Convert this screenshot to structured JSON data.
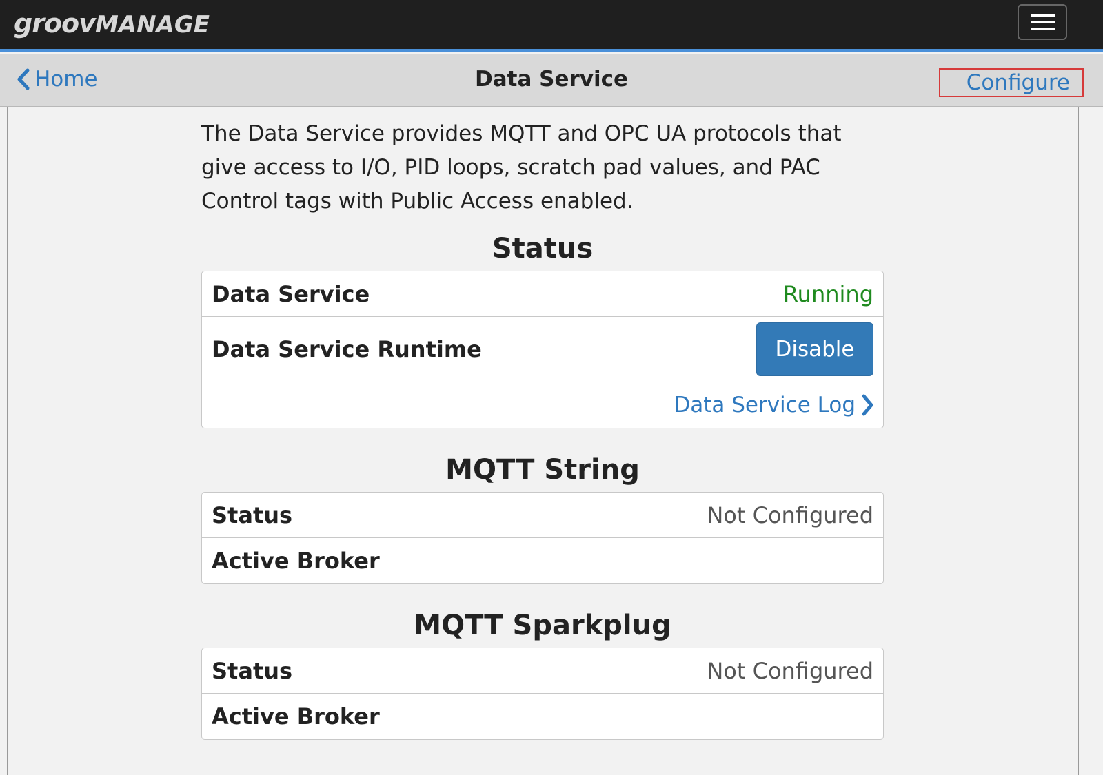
{
  "topbar": {
    "logo_part1": "groov",
    "logo_part2": "MANAGE",
    "menu_icon": "hamburger-icon"
  },
  "subbar": {
    "back_label": "Home",
    "back_icon": "chevron-left-icon",
    "title": "Data Service",
    "configure_label": "Configure"
  },
  "intro": "The Data Service provides MQTT and OPC UA protocols that give access to I/O, PID loops, scratch pad values, and PAC Control tags with Public Access enabled.",
  "status_section": {
    "title": "Status",
    "rows": [
      {
        "label": "Data Service",
        "value": "Running"
      },
      {
        "label": "Data Service Runtime",
        "button": "Disable"
      }
    ],
    "log_link": "Data Service Log",
    "log_icon": "chevron-right-icon"
  },
  "mqtt_string": {
    "title": "MQTT String",
    "rows": [
      {
        "label": "Status",
        "value": "Not Configured"
      },
      {
        "label": "Active Broker",
        "value": ""
      }
    ]
  },
  "mqtt_sparkplug": {
    "title": "MQTT Sparkplug",
    "rows": [
      {
        "label": "Status",
        "value": "Not Configured"
      },
      {
        "label": "Active Broker",
        "value": ""
      }
    ]
  },
  "colors": {
    "topbar": "#1f1f1f",
    "accent_line": "#4a90d9",
    "link": "#2e78be",
    "running": "#1f8a1f",
    "button": "#337ab7",
    "highlight_box": "#d63a3a"
  }
}
